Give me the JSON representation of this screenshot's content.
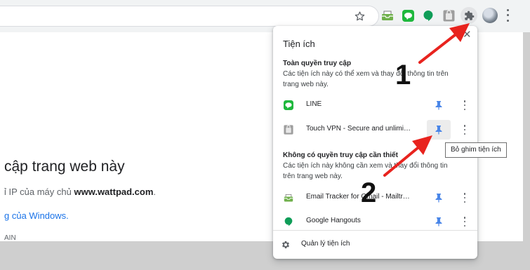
{
  "toolbar": {
    "star_icon": "star-icon",
    "extension_icons": [
      "inbox-tracker-icon",
      "line-icon",
      "hangouts-icon",
      "touch-vpn-icon"
    ],
    "puzzle_icon": "puzzle-icon",
    "menu_icon": "kebab-icon"
  },
  "popup": {
    "title": "Tiện ích",
    "close_icon": "close-icon",
    "full_access": {
      "heading": "Toàn quyền truy cập",
      "description": "Các tiện ích này có thể xem và thay đổi thông tin trên trang web này."
    },
    "no_access": {
      "heading": "Không có quyền truy cập cần thiết",
      "description": "Các tiện ích này không cần xem và thay đổi thông tin trên trang web này."
    },
    "extensions_full": [
      {
        "name": "LINE",
        "icon": "line-icon",
        "pinned": true
      },
      {
        "name": "Touch VPN - Secure and unlimited VPN proxy",
        "icon": "touch-vpn-icon",
        "pinned": true
      }
    ],
    "extensions_none": [
      {
        "name": "Email Tracker for Gmail - Mailtrack",
        "icon": "email-tracker-icon",
        "pinned": true
      },
      {
        "name": "Google Hangouts",
        "icon": "hangouts-icon",
        "pinned": true
      }
    ],
    "manage_label": "Quản lý tiện ích"
  },
  "tooltip": "Bỏ ghim tiện ích",
  "page": {
    "title": "cập trang web này",
    "ip_prefix": "ỉ IP của máy chủ ",
    "ip_domain": "www.wattpad.com",
    "ip_suffix": ".",
    "link": "g của Windows.",
    "code": "AIN"
  },
  "annotations": {
    "label_1": "1",
    "label_2": "2",
    "arrow_color": "#e8231e"
  },
  "colors": {
    "pin_blue": "#4a86e8",
    "line_green": "#1fb83d",
    "hangouts_green": "#0f9d58",
    "link_blue": "#1a73e8"
  }
}
